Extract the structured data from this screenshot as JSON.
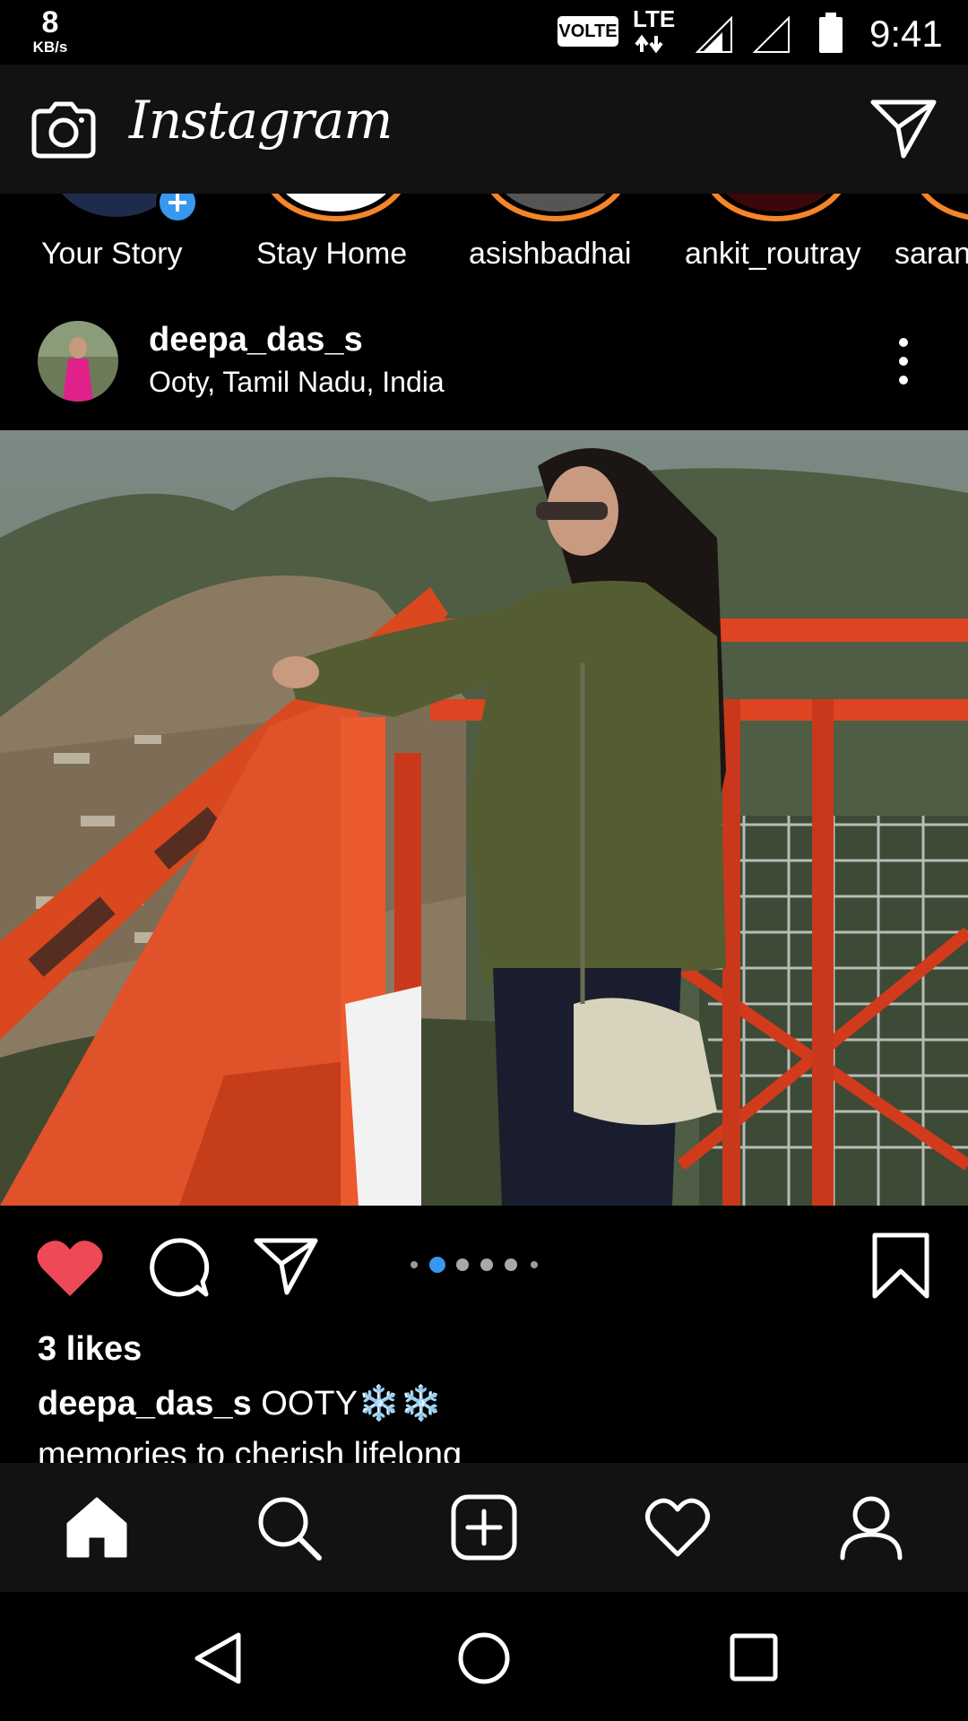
{
  "status_bar": {
    "net_speed_value": "8",
    "net_speed_unit": "KB/s",
    "volte": "VOLTE",
    "network": "LTE",
    "time": "9:41"
  },
  "header": {
    "app_title": "Instagram",
    "camera_icon": "camera-icon",
    "direct_icon": "paper-plane-icon"
  },
  "stories": [
    {
      "label": "Your Story"
    },
    {
      "label": "Stay Home"
    },
    {
      "label": "asishbadhai"
    },
    {
      "label": "ankit_routray"
    },
    {
      "label": "saran"
    }
  ],
  "post": {
    "username": "deepa_das_s",
    "location": "Ooty, Tamil Nadu, India",
    "likes": "3 likes",
    "caption_user": "deepa_das_s",
    "caption_text": "OOTY❄️❄️",
    "caption_second_line": "memories to cherish lifelong"
  },
  "colors": {
    "like_active": "#ed4956",
    "dot_active": "#3897f0",
    "story_ring": "#f58529",
    "nav_background": "#121212"
  },
  "bottom_nav": [
    "home-icon",
    "search-icon",
    "add-post-icon",
    "activity-heart-icon",
    "profile-icon"
  ],
  "system_nav": [
    "back-icon",
    "home-circle-icon",
    "recents-icon"
  ]
}
